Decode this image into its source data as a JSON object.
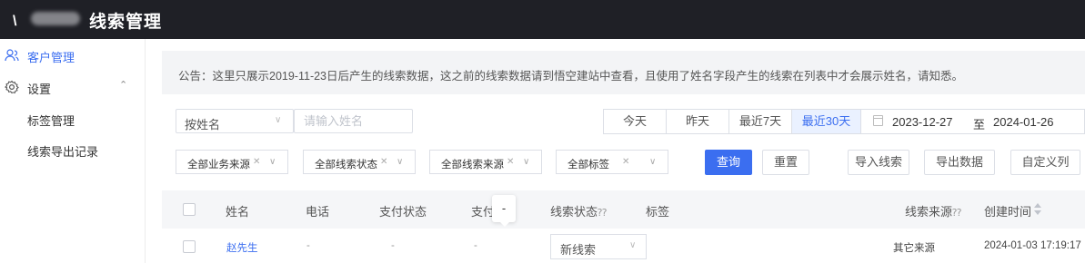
{
  "header": {
    "logo_mark": "\\",
    "app_title": "线索管理"
  },
  "sidebar": {
    "items": [
      {
        "label": "客户管理"
      },
      {
        "label": "设置"
      }
    ],
    "sub_items": [
      {
        "label": "标签管理"
      },
      {
        "label": "线索导出记录"
      }
    ]
  },
  "notice": {
    "text": "公告：这里只展示2019-11-23日后产生的线索数据，这之前的线索数据请到悟空建站中查看，且使用了姓名字段产生的线索在列表中才会展示姓名，请知悉。"
  },
  "search": {
    "field_select": "按姓名",
    "placeholder": "请输入姓名"
  },
  "date_filter": {
    "presets": [
      "今天",
      "昨天",
      "最近7天",
      "最近30天"
    ],
    "active_preset": "最近30天",
    "start": "2023-12-27",
    "separator": "至",
    "end": "2024-01-26"
  },
  "filters": [
    "全部业务来源",
    "全部线索状态",
    "全部线索来源",
    "全部标签"
  ],
  "actions": {
    "query": "查询",
    "reset": "重置",
    "import": "导入线索",
    "export": "导出数据",
    "custom_columns": "自定义列"
  },
  "table": {
    "columns": [
      "姓名",
      "电话",
      "支付状态",
      "支付",
      "线索状态",
      "标签",
      "线索来源",
      "创建时间"
    ],
    "hover_tip": "-",
    "rows": [
      {
        "name": "赵先生",
        "phone": "-",
        "pay_status": "-",
        "pay": "-",
        "status": "新线索",
        "tags": "",
        "source": "其它来源",
        "created": "2024-01-03 17:19:17"
      }
    ]
  },
  "colors": {
    "accent": "#3b6ef0",
    "topbar": "#1f2026"
  }
}
